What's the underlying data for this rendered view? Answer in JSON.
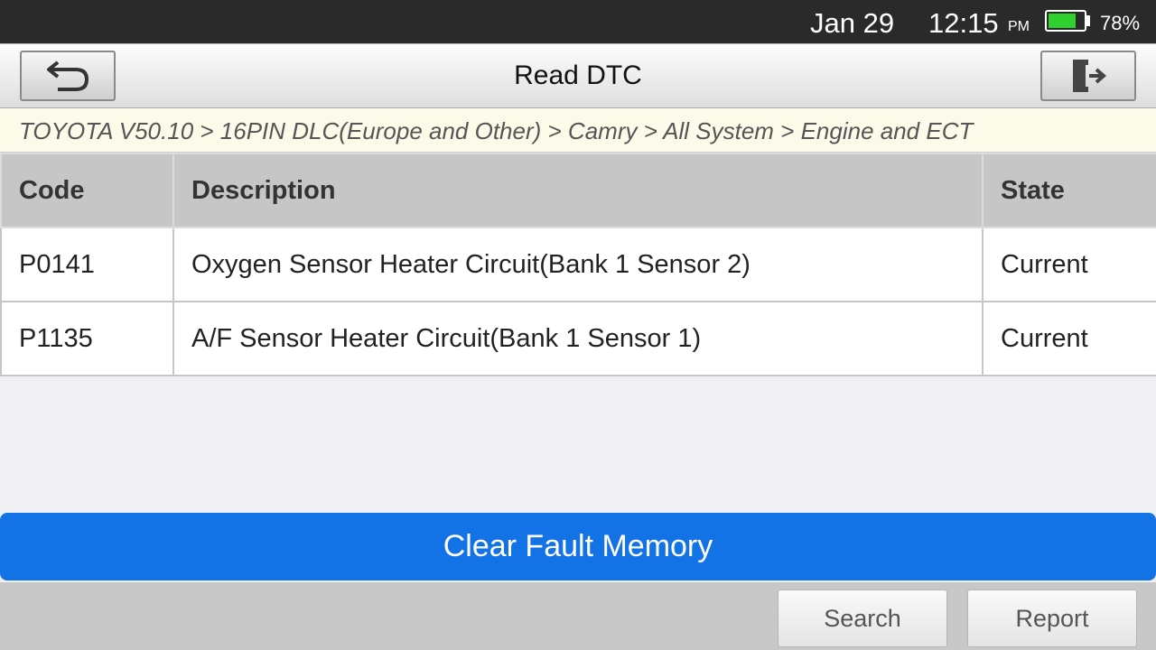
{
  "status_bar": {
    "date": "Jan 29",
    "time": "12:15",
    "ampm": "PM",
    "battery_percent": "78%",
    "battery_level": 0.78,
    "battery_color": "#2fd12f"
  },
  "header": {
    "title": "Read DTC",
    "back_icon": "back-arrow-icon",
    "exit_icon": "exit-door-icon"
  },
  "breadcrumb": "TOYOTA V50.10 > 16PIN DLC(Europe and Other) > Camry > All System > Engine and ECT",
  "table": {
    "columns": [
      "Code",
      "Description",
      "State"
    ],
    "rows": [
      {
        "code": "P0141",
        "description": "Oxygen Sensor Heater Circuit(Bank 1 Sensor 2)",
        "state": "Current"
      },
      {
        "code": "P1135",
        "description": "A/F Sensor Heater Circuit(Bank 1 Sensor 1)",
        "state": "Current"
      }
    ]
  },
  "actions": {
    "clear_label": "Clear Fault Memory",
    "clear_color": "#1372e6",
    "search_label": "Search",
    "report_label": "Report"
  }
}
